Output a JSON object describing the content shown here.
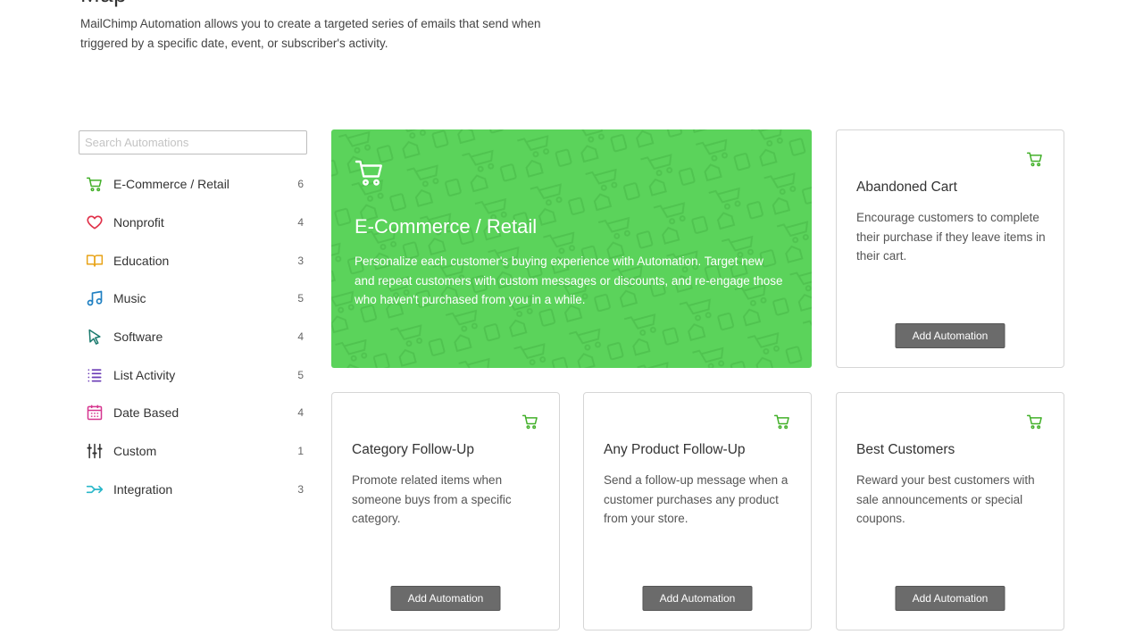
{
  "page": {
    "heading": "Map",
    "intro": "MailChimp Automation allows you to create a targeted series of emails that send when triggered by a specific date, event, or subscriber's activity."
  },
  "sidebar": {
    "search_placeholder": "Search Automations",
    "categories": [
      {
        "label": "E-Commerce / Retail",
        "count": "6",
        "icon": "cart-icon",
        "color": "#43b02a"
      },
      {
        "label": "Nonprofit",
        "count": "4",
        "icon": "heart-icon",
        "color": "#e0324a"
      },
      {
        "label": "Education",
        "count": "3",
        "icon": "book-icon",
        "color": "#e8a317"
      },
      {
        "label": "Music",
        "count": "5",
        "icon": "music-note-icon",
        "color": "#1e7fc2"
      },
      {
        "label": "Software",
        "count": "4",
        "icon": "cursor-icon",
        "color": "#1a7a6e"
      },
      {
        "label": "List Activity",
        "count": "5",
        "icon": "list-icon",
        "color": "#6a3bb5"
      },
      {
        "label": "Date Based",
        "count": "4",
        "icon": "calendar-icon",
        "color": "#d6358f"
      },
      {
        "label": "Custom",
        "count": "1",
        "icon": "sliders-icon",
        "color": "#333333"
      },
      {
        "label": "Integration",
        "count": "3",
        "icon": "integration-arrow-icon",
        "color": "#2ab7c9"
      }
    ]
  },
  "hero": {
    "title": "E-Commerce / Retail",
    "description": "Personalize each customer's buying experience with Automation. Target new and repeat customers with custom messages or discounts, and re-engage those who haven't purchased from you in a while.",
    "background": "#5bd35b",
    "icon": "cart-icon"
  },
  "cards": [
    {
      "title": "Abandoned Cart",
      "description": "Encourage customers to complete their purchase if they leave items in their cart.",
      "button": "Add Automation",
      "icon": "cart-icon"
    },
    {
      "title": "Category Follow-Up",
      "description": "Promote related items when someone buys from a specific category.",
      "button": "Add Automation",
      "icon": "cart-icon"
    },
    {
      "title": "Any Product Follow-Up",
      "description": "Send a follow-up message when a customer purchases any product from your store.",
      "button": "Add Automation",
      "icon": "cart-icon"
    },
    {
      "title": "Best Customers",
      "description": "Reward your best customers with sale announcements or special coupons.",
      "button": "Add Automation",
      "icon": "cart-icon"
    }
  ],
  "colors": {
    "accent_green": "#43b02a",
    "button_gray": "#6b6b6b"
  }
}
